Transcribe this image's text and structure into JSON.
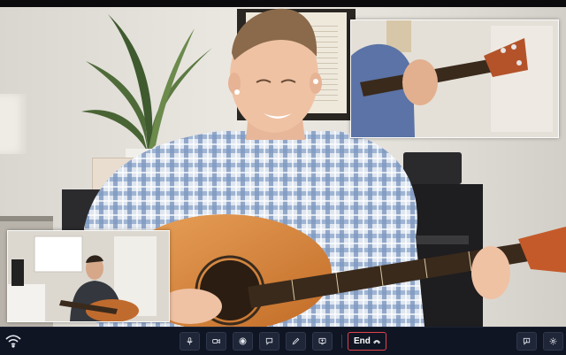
{
  "window": {
    "type": "video-call"
  },
  "participants": {
    "main": {
      "role": "active-speaker"
    },
    "pip_top": {
      "role": "participant"
    },
    "pip_bottom": {
      "role": "self-view"
    }
  },
  "toolbar": {
    "connection_icon": "wifi-icon",
    "buttons": [
      {
        "name": "microphone",
        "icon": "microphone-icon"
      },
      {
        "name": "camera",
        "icon": "video-camera-icon"
      },
      {
        "name": "record",
        "icon": "record-icon"
      },
      {
        "name": "chat",
        "icon": "chat-bubble-icon"
      },
      {
        "name": "annotate",
        "icon": "pencil-icon"
      },
      {
        "name": "screen-share",
        "icon": "screen-share-icon"
      }
    ],
    "end_label": "End",
    "end_icon": "hang-up-icon",
    "right_buttons": [
      {
        "name": "feedback",
        "icon": "feedback-icon"
      },
      {
        "name": "settings",
        "icon": "gear-icon"
      }
    ]
  },
  "colors": {
    "toolbar_bg": "#101524",
    "button_bg": "#1f2638",
    "end_border": "#e0424b",
    "icon": "#e6e9f0"
  }
}
